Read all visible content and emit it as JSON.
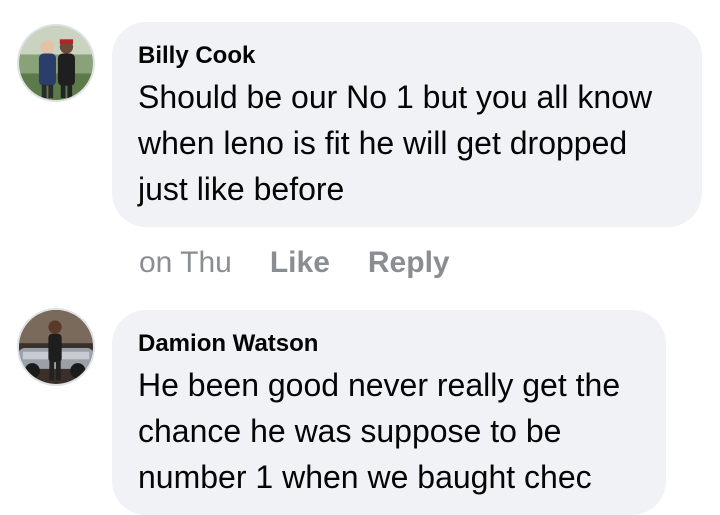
{
  "comments": [
    {
      "author": "Billy Cook",
      "text": "Should be our No 1 but you all know\nwhen leno is fit he will get dropped\njust like before",
      "time": "on Thu",
      "like_label": "Like",
      "reply_label": "Reply"
    },
    {
      "author": "Damion Watson",
      "text": "He been good never really get the\nchance he was suppose to be\nnumber 1 when we baught chec"
    }
  ],
  "colors": {
    "bubble": "#f0f2f5",
    "meta_text": "#8a8d91",
    "body_text": "#050505"
  }
}
